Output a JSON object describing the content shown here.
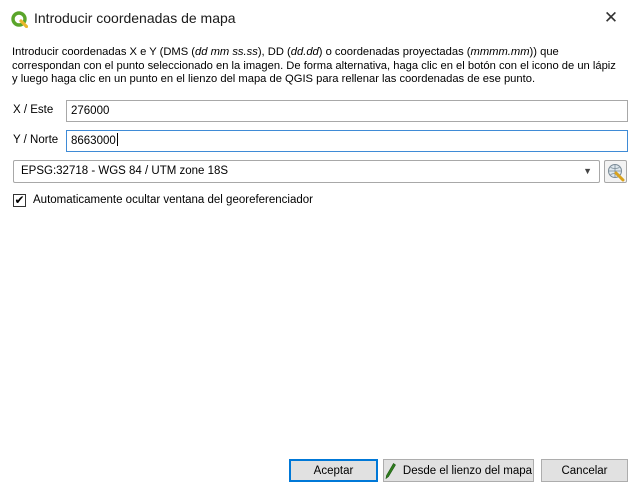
{
  "window": {
    "title": "Introducir coordenadas de mapa",
    "close_glyph": "✕"
  },
  "description": {
    "p1": "Introducir coordenadas X e Y (DMS (",
    "p1_em": "dd mm ss.ss",
    "p2": "), DD (",
    "p2_em": "dd.dd",
    "p3": ") o coordenadas proyectadas (",
    "p3_em": "mmmm.mm",
    "p4": ")) que correspondan con el punto seleccionado en la imagen. De forma alternativa, haga clic en el botón con el icono de un lápiz y luego haga clic en un punto en el lienzo del mapa de QGIS para rellenar las coordenadas de ese punto."
  },
  "fields": {
    "x_label": "X / Este",
    "x_value": "276000",
    "y_label": "Y / Norte",
    "y_value": "8663000"
  },
  "crs": {
    "selected": "EPSG:32718 - WGS 84 / UTM zone 18S",
    "arrow": "▼",
    "button_icon": "crs-selector-icon"
  },
  "options": {
    "auto_hide_label": "Automaticamente ocultar ventana del georeferenciador",
    "auto_hide_checked": true,
    "check_glyph": "✔"
  },
  "buttons": {
    "accept": "Aceptar",
    "from_canvas": "Desde el lienzo del mapa",
    "cancel": "Cancelar"
  },
  "colors": {
    "qgis_green": "#5aa52a",
    "focus_blue": "#3f8bd6",
    "pencil_green": "#2e7d1e"
  },
  "icons": {
    "app": "qgis-logo-icon",
    "pencil": "pencil-icon"
  }
}
